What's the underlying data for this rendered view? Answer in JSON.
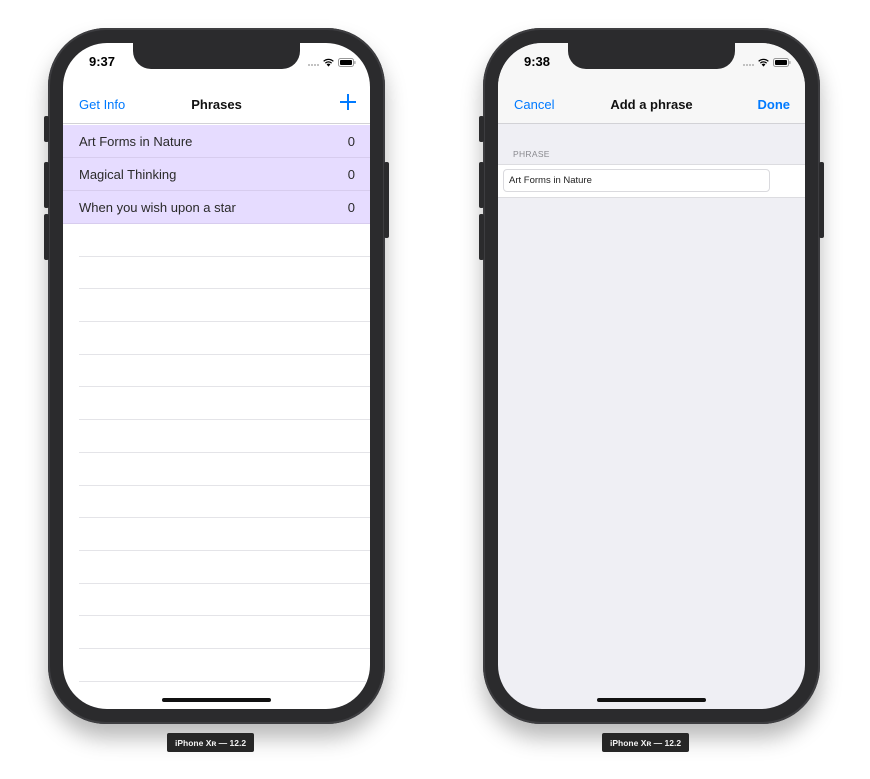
{
  "screens": [
    {
      "status_time": "9:37",
      "nav": {
        "left": "Get Info",
        "title": "Phrases",
        "right_icon": "plus-icon"
      },
      "phrases": [
        {
          "text": "Art Forms in Nature",
          "count": "0"
        },
        {
          "text": "Magical Thinking",
          "count": "0"
        },
        {
          "text": "When you wish upon a star",
          "count": "0"
        }
      ],
      "device_label": "iPhone Xʀ — 12.2"
    },
    {
      "status_time": "9:38",
      "nav": {
        "left": "Cancel",
        "title": "Add a phrase",
        "right": "Done"
      },
      "form": {
        "section_header": "PHRASE",
        "phrase_value": "Art Forms in Nature"
      },
      "device_label": "iPhone Xʀ — 12.2"
    }
  ],
  "colors": {
    "accent": "#007aff",
    "row_highlight": "#e6dcff",
    "grouped_background": "#efeff4"
  }
}
